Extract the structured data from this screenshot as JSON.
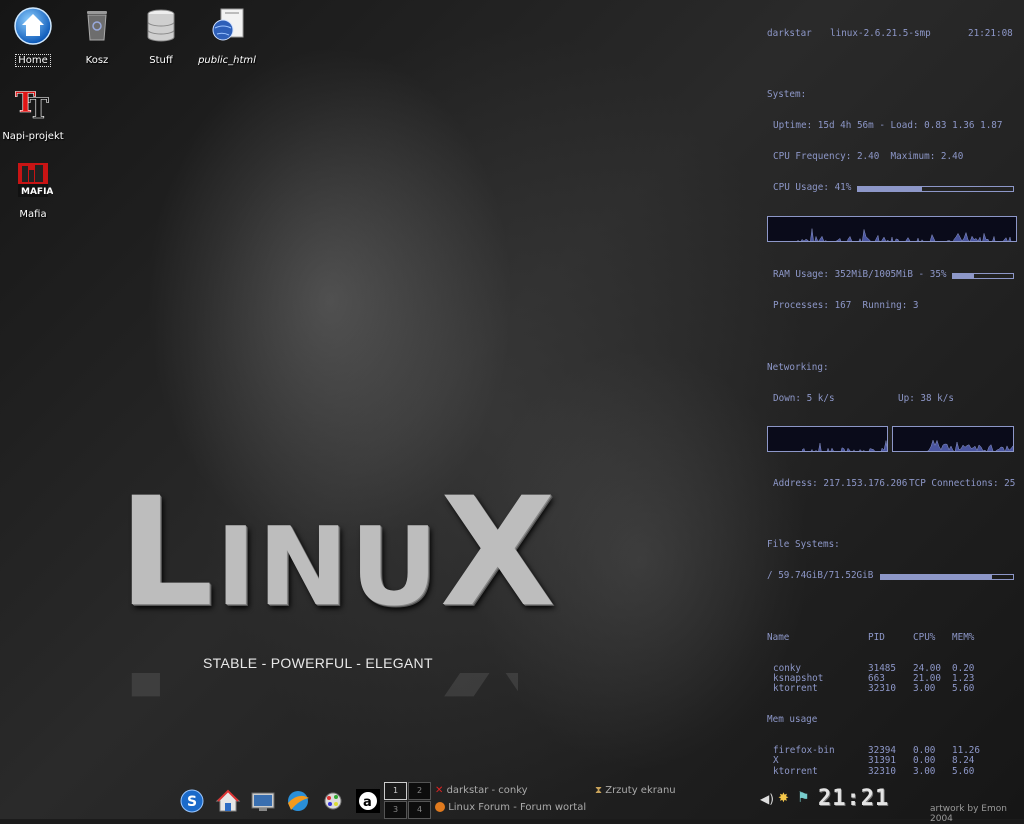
{
  "desktop": {
    "icons": [
      {
        "label": "Home",
        "selected": true
      },
      {
        "label": "Kosz"
      },
      {
        "label": "Stuff"
      },
      {
        "label": "public_html"
      },
      {
        "label": "Napi-projekt"
      },
      {
        "label": "Mafia"
      }
    ]
  },
  "wallpaper": {
    "logo_L": "L",
    "logo_inu": "INU",
    "logo_X": "X",
    "tagline": "STABLE - POWERFUL - ELEGANT",
    "credit": "artwork by Emon 2004"
  },
  "conky": {
    "host": "darkstar",
    "kernel": "linux-2.6.21.5-smp",
    "time": "21:21:08",
    "system_label": "System:",
    "uptime_line": "Uptime: 15d 4h 56m - Load: 0.83 1.36 1.87",
    "cpu_freq_line": "CPU Frequency: 2.40  Maximum: 2.40",
    "cpu_usage_line": "CPU Usage: 41%",
    "cpu_usage_pct": 41,
    "ram_line": "RAM Usage: 352MiB/1005MiB - 35%",
    "ram_pct": 35,
    "processes_line": "Processes: 167  Running: 3",
    "net_label": "Networking:",
    "down_line": "Down: 5 k/s",
    "up_line": "Up: 38 k/s",
    "address_line": "Address: 217.153.176.206",
    "tcp_line": "TCP Connections: 25",
    "fs_label": "File Systems:",
    "fs_line": "/ 59.74GiB/71.52GiB",
    "fs_pct": 84,
    "proc_headers": [
      "Name",
      "PID",
      "CPU%",
      "MEM%"
    ],
    "cpu_procs": [
      [
        "conky",
        "31485",
        "24.00",
        "0.20"
      ],
      [
        "ksnapshot",
        "663",
        "21.00",
        "1.23"
      ],
      [
        "ktorrent",
        "32310",
        "3.00",
        "5.60"
      ]
    ],
    "mem_label": "Mem usage",
    "mem_procs": [
      [
        "firefox-bin",
        "32394",
        "0.00",
        "11.26"
      ],
      [
        "X",
        "31391",
        "0.00",
        "8.24"
      ],
      [
        "ktorrent",
        "32310",
        "3.00",
        "5.60"
      ]
    ]
  },
  "taskbar": {
    "launchers": [
      "skype-icon",
      "home-icon",
      "monitor-icon",
      "browser-icon",
      "settings-icon",
      "amarok-icon"
    ],
    "pager": [
      "1",
      "2",
      "3",
      "4"
    ],
    "tasks": [
      {
        "label": "darkstar - conky"
      },
      {
        "label": "Linux Forum - Forum wortalu JA"
      },
      {
        "label": "Zrzuty ekranu"
      }
    ],
    "clock": "21:21"
  }
}
